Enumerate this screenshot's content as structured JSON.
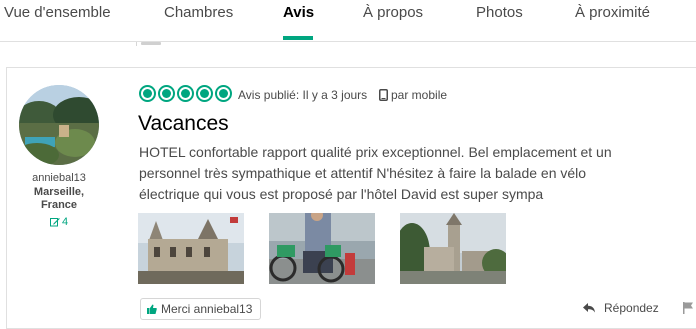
{
  "tabs": [
    {
      "label": "Vue d'ensemble"
    },
    {
      "label": "Chambres"
    },
    {
      "label": "Avis"
    },
    {
      "label": "À propos"
    },
    {
      "label": "Photos"
    },
    {
      "label": "À proximité"
    }
  ],
  "active_tab": "Avis",
  "colors": {
    "accent": "#00a680",
    "text": "#4a4a4a",
    "title": "#000000",
    "border": "#e0e0e0"
  },
  "review": {
    "user": {
      "username": "anniebal13",
      "city": "Marseille,",
      "country": "France",
      "contributions": "4",
      "contributions_icon": "pencil-icon"
    },
    "rating": 5,
    "rating_max": 5,
    "published": "Avis publié: Il y a 3 jours",
    "device": "par mobile",
    "device_icon": "mobile-phone-icon",
    "title": "Vacances",
    "body": "HOTEL confortable rapport qualité prix exceptionnel. Bel emplacement et un personnel très sympathique et attentif N'hésitez à faire la balade en vélo électrique qui vous est proposé par l'hôtel David est super sympa",
    "photos_count": 3,
    "actions": {
      "thanks_label": "Merci anniebal13",
      "thanks_icon": "thumbs-up-icon",
      "reply_label": "Répondez",
      "reply_icon": "reply-arrow-icon",
      "flag_icon": "flag-icon"
    }
  }
}
